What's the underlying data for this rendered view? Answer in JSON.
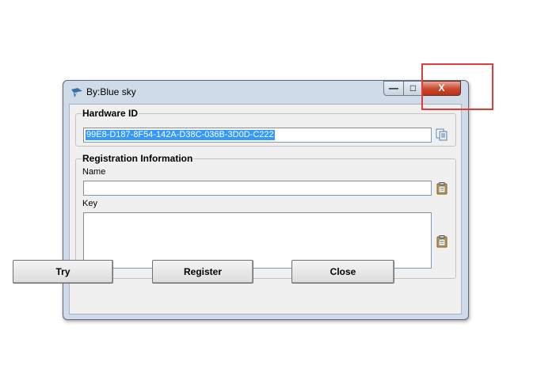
{
  "window": {
    "title": "By:Blue sky"
  },
  "controls": {
    "minimize_glyph": "—",
    "maximize_glyph": "□",
    "close_glyph": "X"
  },
  "hardware": {
    "group_title": "Hardware ID",
    "value": "99E8-D187-8F54-142A-D38C-036B-3D0D-C222",
    "copy_icon": "copy-icon"
  },
  "registration": {
    "group_title": "Registration Information",
    "name_label": "Name",
    "name_value": "",
    "key_label": "Key",
    "key_value": "",
    "paste_icon": "paste-icon"
  },
  "buttons": {
    "try": "Try",
    "register": "Register",
    "close": "Close"
  },
  "colors": {
    "selection": "#3399ff",
    "annotation_box": "#e03a3a",
    "close_button": "#c9472b"
  }
}
